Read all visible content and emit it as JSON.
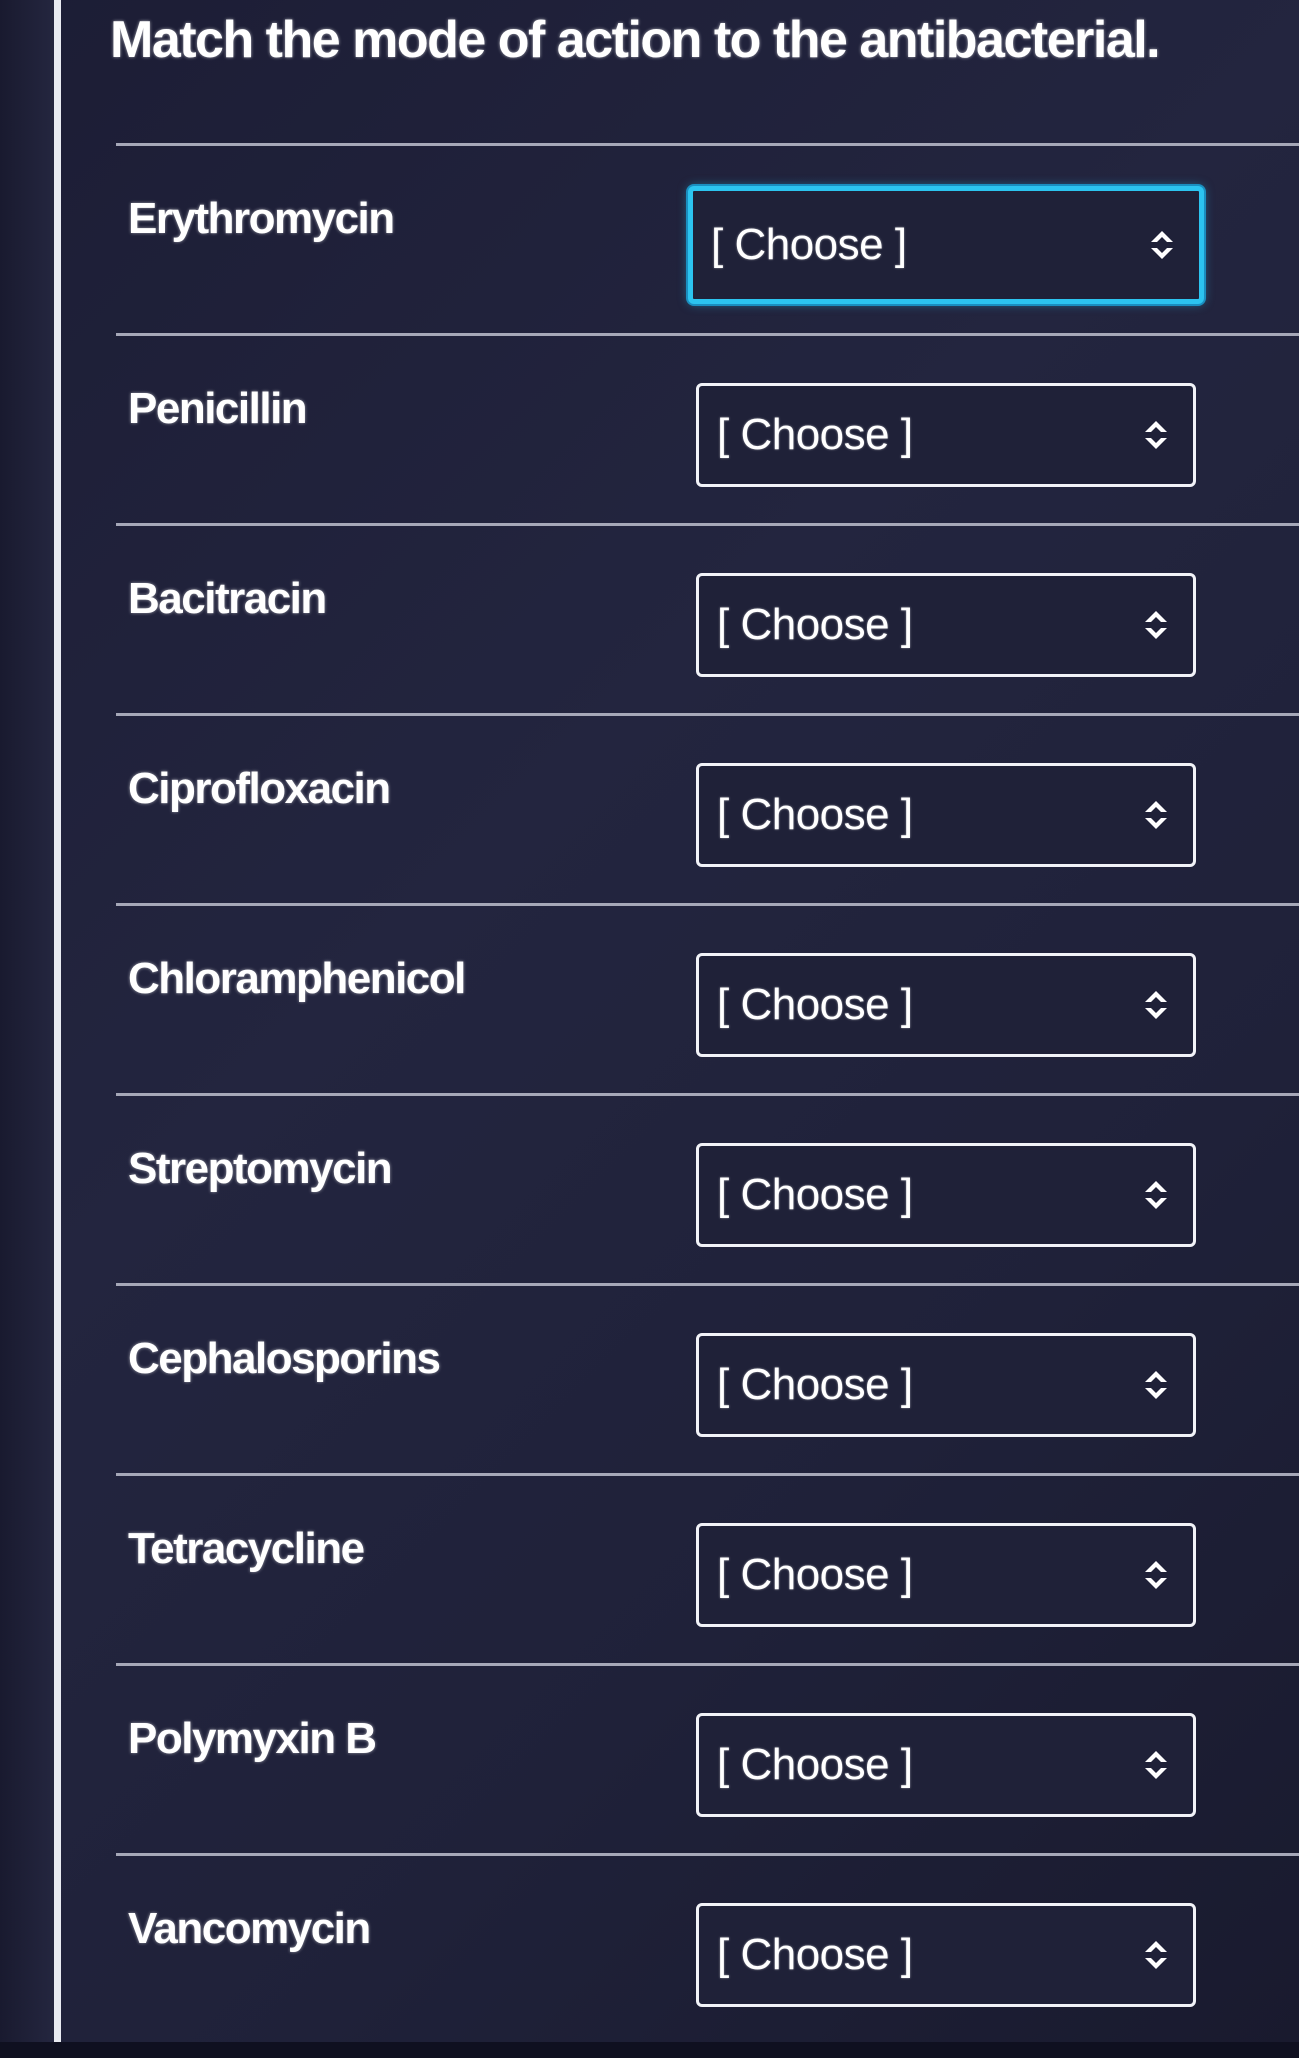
{
  "question": {
    "text": "Match the mode of action to the antibacterial."
  },
  "items": [
    {
      "drug": "Erythromycin",
      "select_value": "[ Choose ]"
    },
    {
      "drug": "Penicillin",
      "select_value": "[ Choose ]"
    },
    {
      "drug": "Bacitracin",
      "select_value": "[ Choose ]"
    },
    {
      "drug": "Ciprofloxacin",
      "select_value": "[ Choose ]"
    },
    {
      "drug": "Chloramphenicol",
      "select_value": "[ Choose ]"
    },
    {
      "drug": "Streptomycin",
      "select_value": "[ Choose ]"
    },
    {
      "drug": "Cephalosporins",
      "select_value": "[ Choose ]"
    },
    {
      "drug": "Tetracycline",
      "select_value": "[ Choose ]"
    },
    {
      "drug": "Polymyxin B",
      "select_value": "[ Choose ]"
    },
    {
      "drug": "Vancomycin",
      "select_value": "[ Choose ]"
    }
  ],
  "icons": {
    "select_arrow": "chevron-up-down-icon"
  },
  "colors": {
    "background": "#1f2139",
    "focus_ring": "#2cc4f0",
    "text": "#ffffff",
    "divider": "#a6a8b8"
  },
  "focused_index": 0
}
